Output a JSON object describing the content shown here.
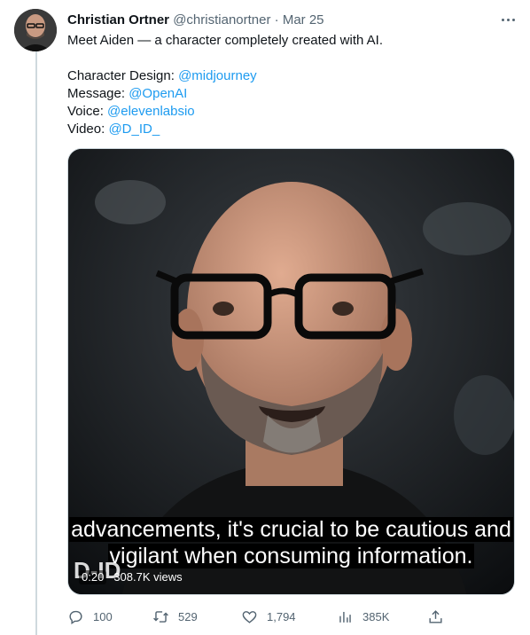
{
  "tweet": {
    "author_name": "Christian Ortner",
    "handle": "@christianortner",
    "separator": "·",
    "date": "Mar 25",
    "text_intro": "Meet Aiden — a character completely created with AI.",
    "credits": [
      {
        "label": "Character Design: ",
        "mention": "@midjourney"
      },
      {
        "label": "Message: ",
        "mention": "@OpenAI"
      },
      {
        "label": "Voice: ",
        "mention": "@elevenlabsio"
      },
      {
        "label": "Video: ",
        "mention": "@D_ID_"
      }
    ]
  },
  "video": {
    "caption_line1": "advancements, it's crucial to be cautious and",
    "caption_line2": "vigilant when consuming information.",
    "watermark": "D-ID",
    "timestamp": "0:20",
    "views": "308.7K views"
  },
  "actions": {
    "replies": "100",
    "retweets": "529",
    "likes": "1,794",
    "views": "385K"
  },
  "icons": {
    "more": "more-horizontal-icon",
    "reply": "reply-bubble-icon",
    "retweet": "retweet-icon",
    "like": "heart-icon",
    "analytics": "bar-chart-icon",
    "share": "share-upload-icon"
  },
  "colors": {
    "accent": "#1d9bf0",
    "secondary_text": "#536471",
    "primary_text": "#0f1419"
  }
}
